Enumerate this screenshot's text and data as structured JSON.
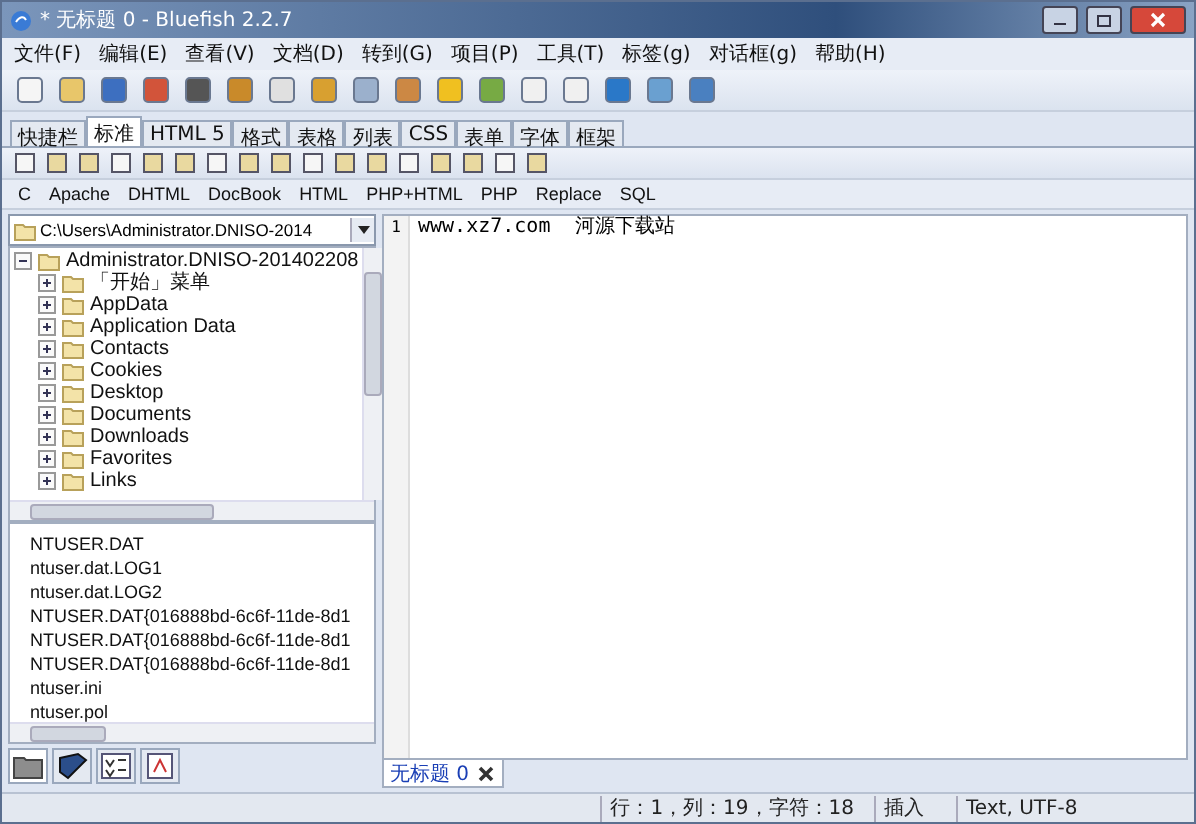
{
  "window": {
    "title": "* 无标题 0 - Bluefish 2.2.7"
  },
  "menu": [
    "文件(F)",
    "编辑(E)",
    "查看(V)",
    "文档(D)",
    "转到(G)",
    "项目(P)",
    "工具(T)",
    "标签(g)",
    "对话框(g)",
    "帮助(H)"
  ],
  "tabs": [
    {
      "label": "快捷栏",
      "selected": false
    },
    {
      "label": "标准",
      "selected": true
    },
    {
      "label": "HTML 5",
      "selected": false
    },
    {
      "label": "格式",
      "selected": false
    },
    {
      "label": "表格",
      "selected": false
    },
    {
      "label": "列表",
      "selected": false
    },
    {
      "label": "CSS",
      "selected": false
    },
    {
      "label": "表单",
      "selected": false
    },
    {
      "label": "字体",
      "selected": false
    },
    {
      "label": "框架",
      "selected": false
    }
  ],
  "languages": [
    "C",
    "Apache",
    "DHTML",
    "DocBook",
    "HTML",
    "PHP+HTML",
    "PHP",
    "Replace",
    "SQL"
  ],
  "sidebar": {
    "path": "C:\\Users\\Administrator.DNISO-2014",
    "tree": [
      {
        "name": "Administrator.DNISO-201402208",
        "expanded": true,
        "children": [
          {
            "name": "「开始」菜单",
            "expanded": false
          },
          {
            "name": "AppData",
            "expanded": false
          },
          {
            "name": "Application Data",
            "expanded": false
          },
          {
            "name": "Contacts",
            "expanded": false
          },
          {
            "name": "Cookies",
            "expanded": false
          },
          {
            "name": "Desktop",
            "expanded": false
          },
          {
            "name": "Documents",
            "expanded": false
          },
          {
            "name": "Downloads",
            "expanded": false
          },
          {
            "name": "Favorites",
            "expanded": false
          },
          {
            "name": "Links",
            "expanded": false
          }
        ]
      }
    ],
    "files": [
      "NTUSER.DAT",
      "ntuser.dat.LOG1",
      "ntuser.dat.LOG2",
      "NTUSER.DAT{016888bd-6c6f-11de-8d1",
      "NTUSER.DAT{016888bd-6c6f-11de-8d1",
      "NTUSER.DAT{016888bd-6c6f-11de-8d1",
      "ntuser.ini",
      "ntuser.pol"
    ],
    "panel_tabs": [
      {
        "kind": "folder",
        "selected": true
      },
      {
        "kind": "bookmark",
        "selected": false
      },
      {
        "kind": "chars",
        "selected": false
      },
      {
        "kind": "snippet",
        "selected": false
      }
    ]
  },
  "editor": {
    "lines": [
      {
        "number": "1",
        "text": "www.xz7.com  河源下载站"
      }
    ],
    "tabs": [
      {
        "label": "无标题 0",
        "selected": true
      }
    ]
  },
  "status_bar": {
    "position": "行：1，列：19，字符：18",
    "mode": "插入",
    "encoding": "Text, UTF-8"
  }
}
